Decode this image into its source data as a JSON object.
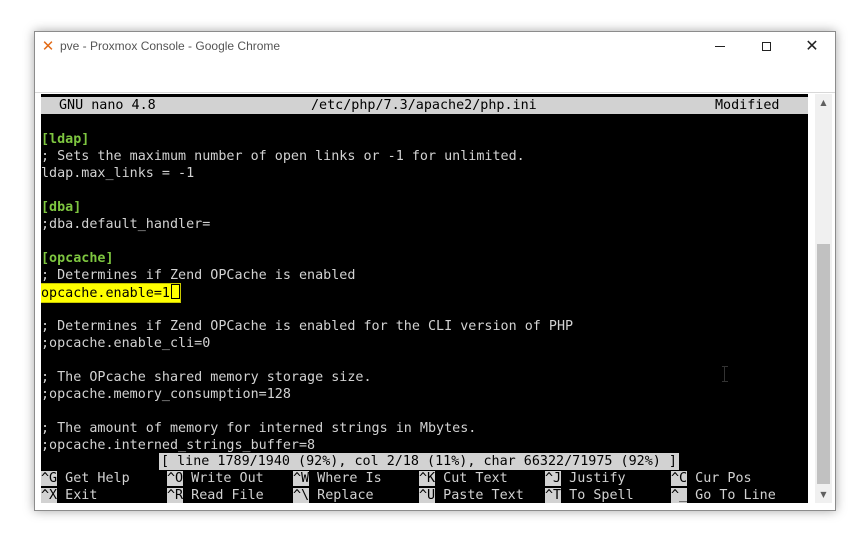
{
  "window": {
    "title": "pve - Proxmox Console - Google Chrome",
    "app_icon": "proxmox-x-icon",
    "controls": {
      "minimize": "−",
      "maximize": "□",
      "close": "✕"
    }
  },
  "nano": {
    "header": {
      "version": "GNU nano 4.8",
      "file": "/etc/php/7.3/apache2/php.ini",
      "state": "Modified"
    },
    "lines": [
      {
        "kind": "blank",
        "text": ""
      },
      {
        "kind": "section",
        "text": "[ldap]"
      },
      {
        "kind": "text",
        "text": "; Sets the maximum number of open links or -1 for unlimited."
      },
      {
        "kind": "text",
        "text": "ldap.max_links = -1"
      },
      {
        "kind": "blank",
        "text": ""
      },
      {
        "kind": "section",
        "text": "[dba]"
      },
      {
        "kind": "text",
        "text": ";dba.default_handler="
      },
      {
        "kind": "blank",
        "text": ""
      },
      {
        "kind": "section",
        "text": "[opcache]"
      },
      {
        "kind": "text",
        "text": "; Determines if Zend OPCache is enabled"
      },
      {
        "kind": "highlight",
        "text": "opcache.enable=1"
      },
      {
        "kind": "blank",
        "text": ""
      },
      {
        "kind": "text",
        "text": "; Determines if Zend OPCache is enabled for the CLI version of PHP"
      },
      {
        "kind": "text",
        "text": ";opcache.enable_cli=0"
      },
      {
        "kind": "blank",
        "text": ""
      },
      {
        "kind": "text",
        "text": "; The OPcache shared memory storage size."
      },
      {
        "kind": "text",
        "text": ";opcache.memory_consumption=128"
      },
      {
        "kind": "blank",
        "text": ""
      },
      {
        "kind": "text",
        "text": "; The amount of memory for interned strings in Mbytes."
      },
      {
        "kind": "text",
        "text": ";opcache.interned_strings_buffer=8"
      }
    ],
    "status": "[ line 1789/1940 (92%), col 2/18 (11%), char 66322/71975 (92%) ]",
    "shortcuts": [
      [
        {
          "key": "^G",
          "label": "Get Help"
        },
        {
          "key": "^O",
          "label": "Write Out"
        },
        {
          "key": "^W",
          "label": "Where Is"
        },
        {
          "key": "^K",
          "label": "Cut Text"
        },
        {
          "key": "^J",
          "label": "Justify"
        },
        {
          "key": "^C",
          "label": "Cur Pos"
        }
      ],
      [
        {
          "key": "^X",
          "label": "Exit"
        },
        {
          "key": "^R",
          "label": "Read File"
        },
        {
          "key": "^\\",
          "label": "Replace"
        },
        {
          "key": "^U",
          "label": "Paste Text"
        },
        {
          "key": "^T",
          "label": "To Spell"
        },
        {
          "key": "^_",
          "label": "Go To Line"
        }
      ]
    ]
  },
  "scrollbar": {
    "up": "▲",
    "down": "▼",
    "position_fraction": 0.92
  }
}
